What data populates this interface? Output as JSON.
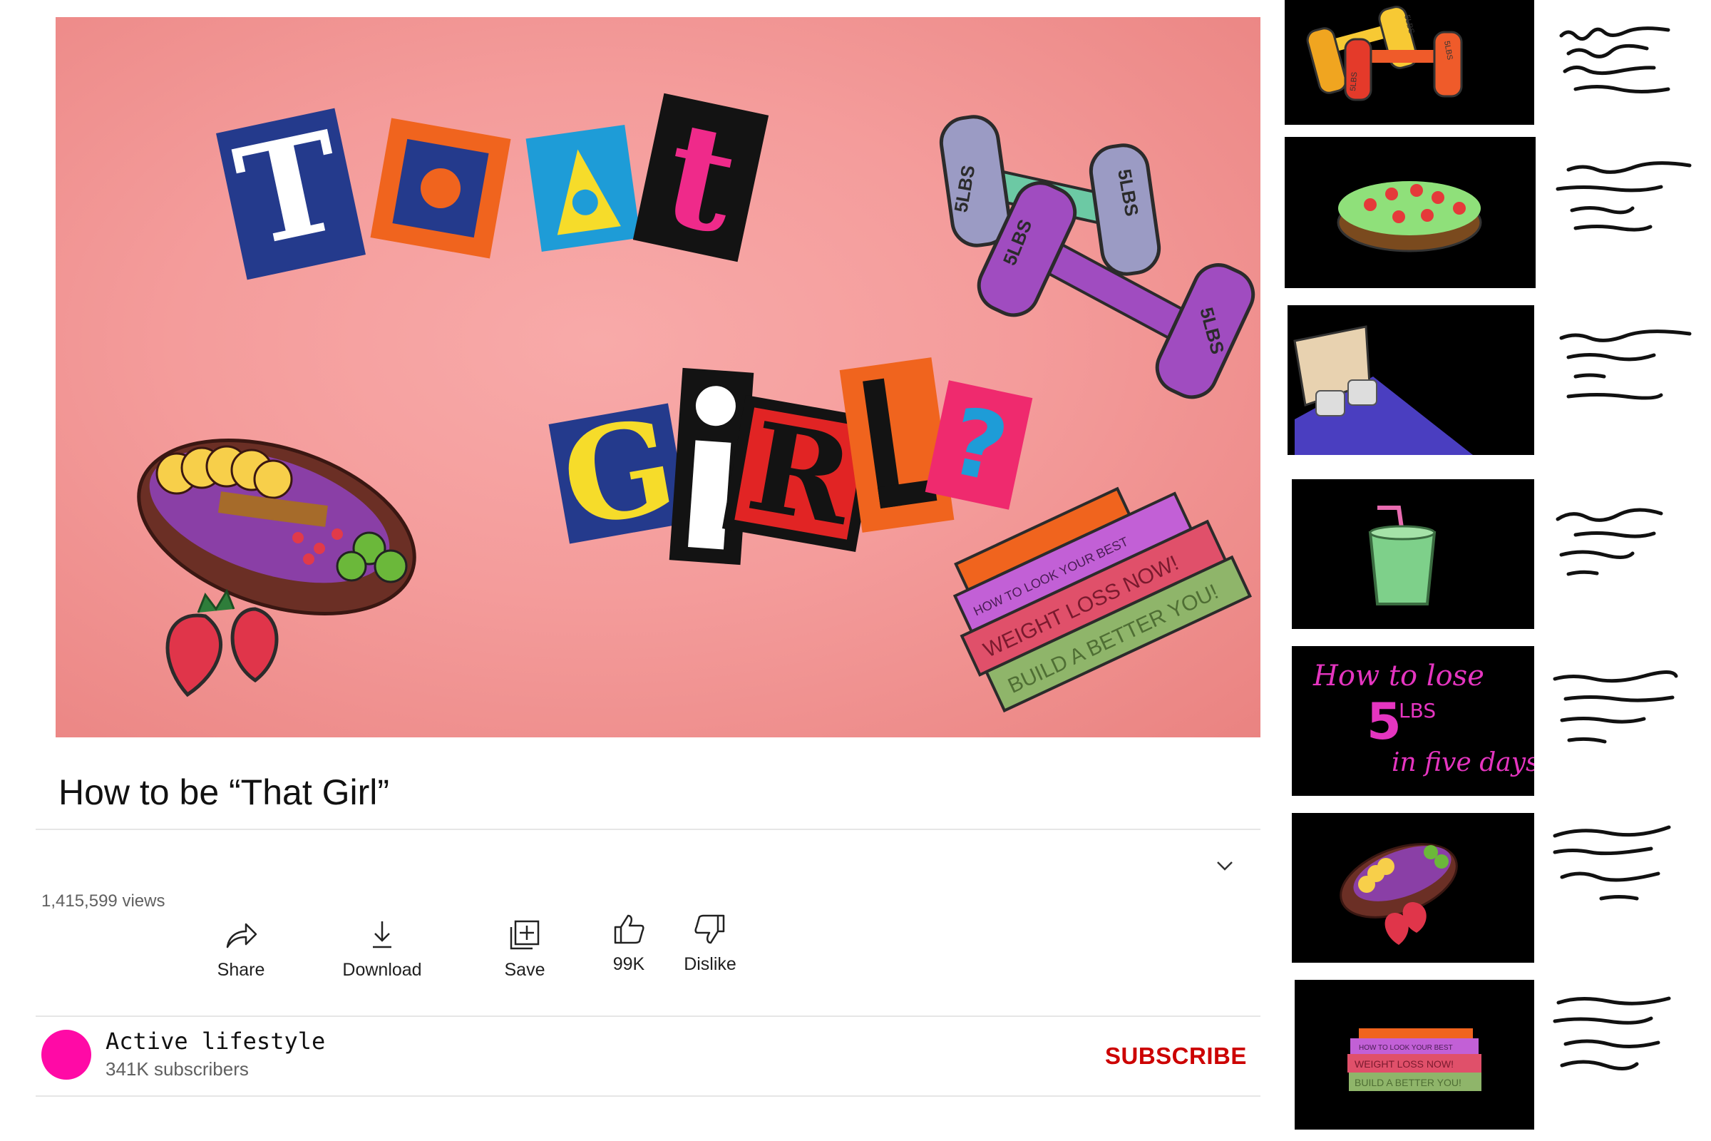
{
  "video": {
    "title": "How to be “That Girl”",
    "views": "1,415,599 views",
    "artwork": {
      "dumbbell_label": "5LBS",
      "book_titles": [
        "HOW TO LOOK YOUR BEST",
        "WEIGHT LOSS NOW!",
        "BUILD A BETTER YOU!"
      ]
    }
  },
  "actions": {
    "share": "Share",
    "download": "Download",
    "save": "Save",
    "like_count": "99K",
    "dislike": "Dislike"
  },
  "channel": {
    "name": "Active lifestyle",
    "subscribers": "341K subscribers",
    "subscribe_label": "SUBSCRIBE",
    "avatar_color": "#ff0aa6"
  },
  "sidebar": {
    "thumbnails": [
      {
        "subject": "dumbbells",
        "labels": [
          "5LBS",
          "5LBS",
          "5LBS"
        ]
      },
      {
        "subject": "salad-bowl"
      },
      {
        "subject": "bed"
      },
      {
        "subject": "green-smoothie"
      },
      {
        "subject": "text-card",
        "lines": [
          "How to lose",
          "5",
          "LBS",
          "in five days"
        ]
      },
      {
        "subject": "acai-bowl"
      },
      {
        "subject": "book-stack",
        "labels": [
          "HOW TO LOOK YOUR BEST",
          "WEIGHT LOSS NOW!",
          "BUILD A BETTER YOU!"
        ]
      }
    ]
  },
  "colors": {
    "background": "#ffffff",
    "player_pink": "#f49c9b",
    "subscribe_red": "#cc0000",
    "secondary_text": "#606060"
  }
}
